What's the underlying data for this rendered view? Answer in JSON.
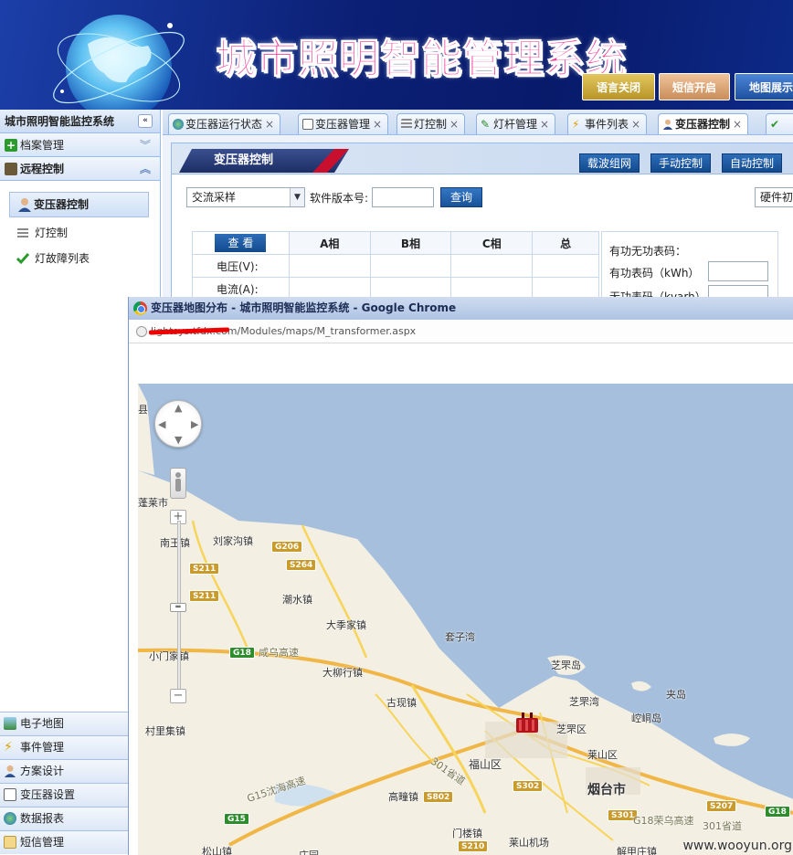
{
  "header": {
    "system_title": "城市照明智能管理系统",
    "buttons": [
      {
        "label": "语言关闭",
        "color": "#c8ad3c"
      },
      {
        "label": "短信开启",
        "color": "#d8a16e"
      },
      {
        "label": "地图展示",
        "color": "#2d62b3"
      }
    ]
  },
  "sidebar": {
    "title": "城市照明智能监控系统",
    "sections": [
      {
        "label": "档案管理",
        "icon": "plus-icon"
      },
      {
        "label": "远程控制",
        "icon": "control-icon"
      }
    ],
    "sub_items": [
      {
        "label": "变压器控制",
        "icon": "user-icon",
        "selected": true
      },
      {
        "label": "灯控制",
        "icon": "list-icon"
      },
      {
        "label": "灯故障列表",
        "icon": "check-icon"
      }
    ],
    "bottom_sections": [
      {
        "label": "电子地图",
        "icon": "map-icon"
      },
      {
        "label": "事件管理",
        "icon": "lightning-icon"
      },
      {
        "label": "方案设计",
        "icon": "user-icon"
      },
      {
        "label": "变压器设置",
        "icon": "grid-icon"
      },
      {
        "label": "数据报表",
        "icon": "globe-icon"
      },
      {
        "label": "短信管理",
        "icon": "mail-icon"
      }
    ]
  },
  "tabs": [
    {
      "label": "变压器运行状态",
      "icon": "globe-icon"
    },
    {
      "label": "变压器管理",
      "icon": "grid-icon"
    },
    {
      "label": "灯控制",
      "icon": "list-icon"
    },
    {
      "label": "灯杆管理",
      "icon": "pencil-icon"
    },
    {
      "label": "事件列表",
      "icon": "lightning-icon"
    },
    {
      "label": "变压器控制",
      "icon": "user-icon",
      "active": true
    },
    {
      "label": "",
      "icon": "check-icon"
    }
  ],
  "panel": {
    "title": "变压器控制",
    "actions": [
      "载波组网",
      "手动控制",
      "自动控制"
    ],
    "select_value": "交流采样",
    "version_label": "软件版本号:",
    "query_button": "查询",
    "hardware_label": "硬件初",
    "table": {
      "button": "查 看",
      "headers": [
        "A相",
        "B相",
        "C相",
        "总"
      ],
      "rows": [
        "电压(V):",
        "电流(A):"
      ]
    },
    "meter": {
      "reactive_code_label": "有功无功表码：",
      "active_label": "有功表码（kWh）",
      "reactive_label": "无功表码（kvarh）"
    }
  },
  "popup": {
    "window_title": "变压器地图分布 - 城市照明智能监控系统 - Google Chrome",
    "url": "lightsys.tfdx.com/Modules/maps/M_transformer.aspx"
  },
  "map": {
    "places": [
      "县",
      "蓬莱市",
      "南王镇",
      "刘家沟镇",
      "潮水镇",
      "大季家镇",
      "小门家镇",
      "大柳行镇",
      "套子湾",
      "芝罘岛",
      "古现镇",
      "芝罘湾",
      "崆峒岛",
      "夹岛",
      "芝罘区",
      "莱山区",
      "福山区",
      "村里集镇",
      "烟台市",
      "高疃镇",
      "门楼镇",
      "莱山机场",
      "解甲庄镇",
      "松山镇",
      "庄园"
    ],
    "roads": [
      "G206",
      "S264",
      "S211",
      "S211",
      "G18",
      "咸乌高速",
      "301省道",
      "G15沈海高速",
      "G15",
      "S302",
      "S802",
      "S210",
      "S301",
      "G18荣乌高速",
      "S207",
      "301省道",
      "G18"
    ]
  },
  "watermark": "www.wooyun.org"
}
